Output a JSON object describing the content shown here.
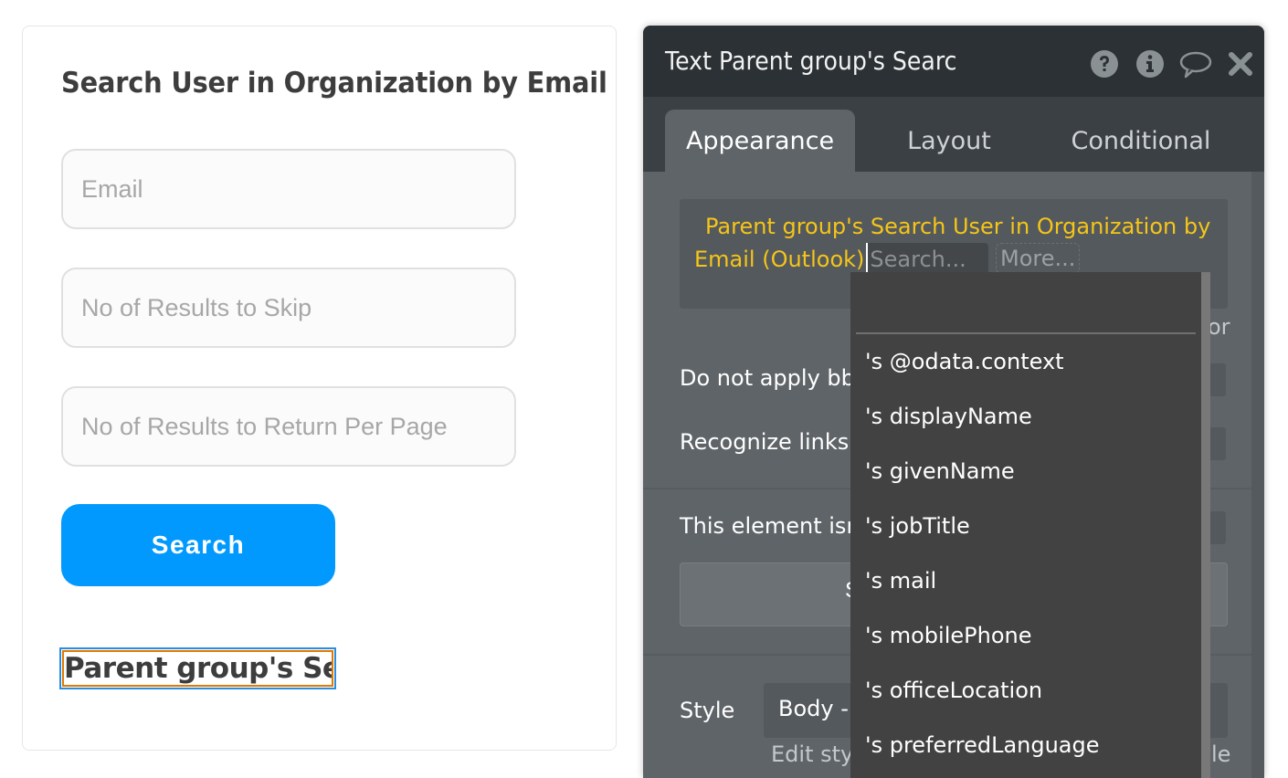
{
  "canvas": {
    "title": "Search User in Organization by Email",
    "fields": [
      {
        "placeholder": "Email",
        "value": ""
      },
      {
        "placeholder": "No of Results to Skip",
        "value": ""
      },
      {
        "placeholder": "No of Results to Return Per Page",
        "value": ""
      }
    ],
    "search_button": "Search",
    "selected_text": "Parent group's Se..."
  },
  "panel": {
    "title": "Text Parent group's Searc",
    "header_icons": [
      "help-icon",
      "info-icon",
      "comment-icon",
      "close-icon"
    ],
    "tabs": [
      {
        "label": "Appearance",
        "active": true
      },
      {
        "label": "Layout",
        "active": false
      },
      {
        "label": "Conditional",
        "active": false
      }
    ],
    "expression": {
      "line1": "Parent group's Search User in Organization by",
      "line2": "Email (Outlook)",
      "search_placeholder": "Search...",
      "more_label": "More..."
    },
    "partial_right_text": "or",
    "rows": {
      "no_bbcode": "Do not apply bb-",
      "recognize_links": "Recognize links a",
      "not_clickable": "This element isn'",
      "wide_button_partial": "S"
    },
    "style": {
      "label": "Style",
      "value": "Body -",
      "edit_label": "Edit styl",
      "edit_right": "le"
    },
    "colors": {
      "expression": "#f5c518",
      "header_bg": "#2b3134",
      "panel_bg": "#5f6468"
    }
  },
  "dropdown": {
    "search_value": "",
    "items": [
      "'s @odata.context",
      "'s displayName",
      "'s givenName",
      "'s jobTitle",
      "'s mail",
      "'s mobilePhone",
      "'s officeLocation",
      "'s preferredLanguage"
    ]
  }
}
